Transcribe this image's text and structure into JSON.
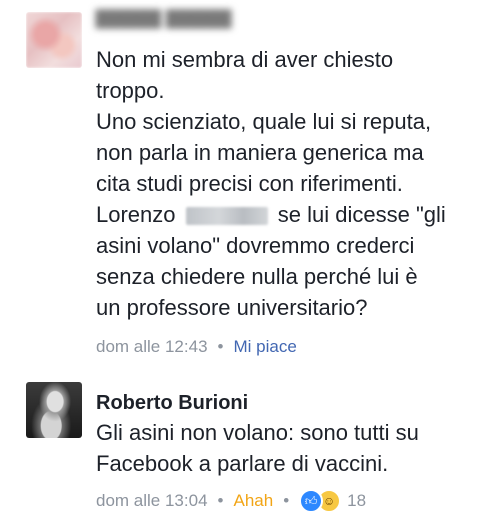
{
  "comments": [
    {
      "text_before": "Non mi sembra di aver chiesto\ntroppo.\nUno scienziato, quale lui si reputa,\nnon parla in maniera generica ma\ncita studi precisi con riferimenti.\nLorenzo",
      "text_after": "se lui dicesse \"gli\nasini volano\" dovremmo crederci\nsenza chiedere nulla perché lui è\nun professore universitario?",
      "time": "dom alle 12:43",
      "separator": "•",
      "action": "Mi piace"
    },
    {
      "author": "Roberto Burioni",
      "text": "Gli asini non volano: sono tutti su\nFacebook a parlare di vaccini.",
      "time": "dom alle 13:04",
      "separator": "•",
      "action": "Ahah",
      "reaction_count": "18",
      "reactions": [
        "like-icon",
        "haha-icon"
      ]
    }
  ]
}
